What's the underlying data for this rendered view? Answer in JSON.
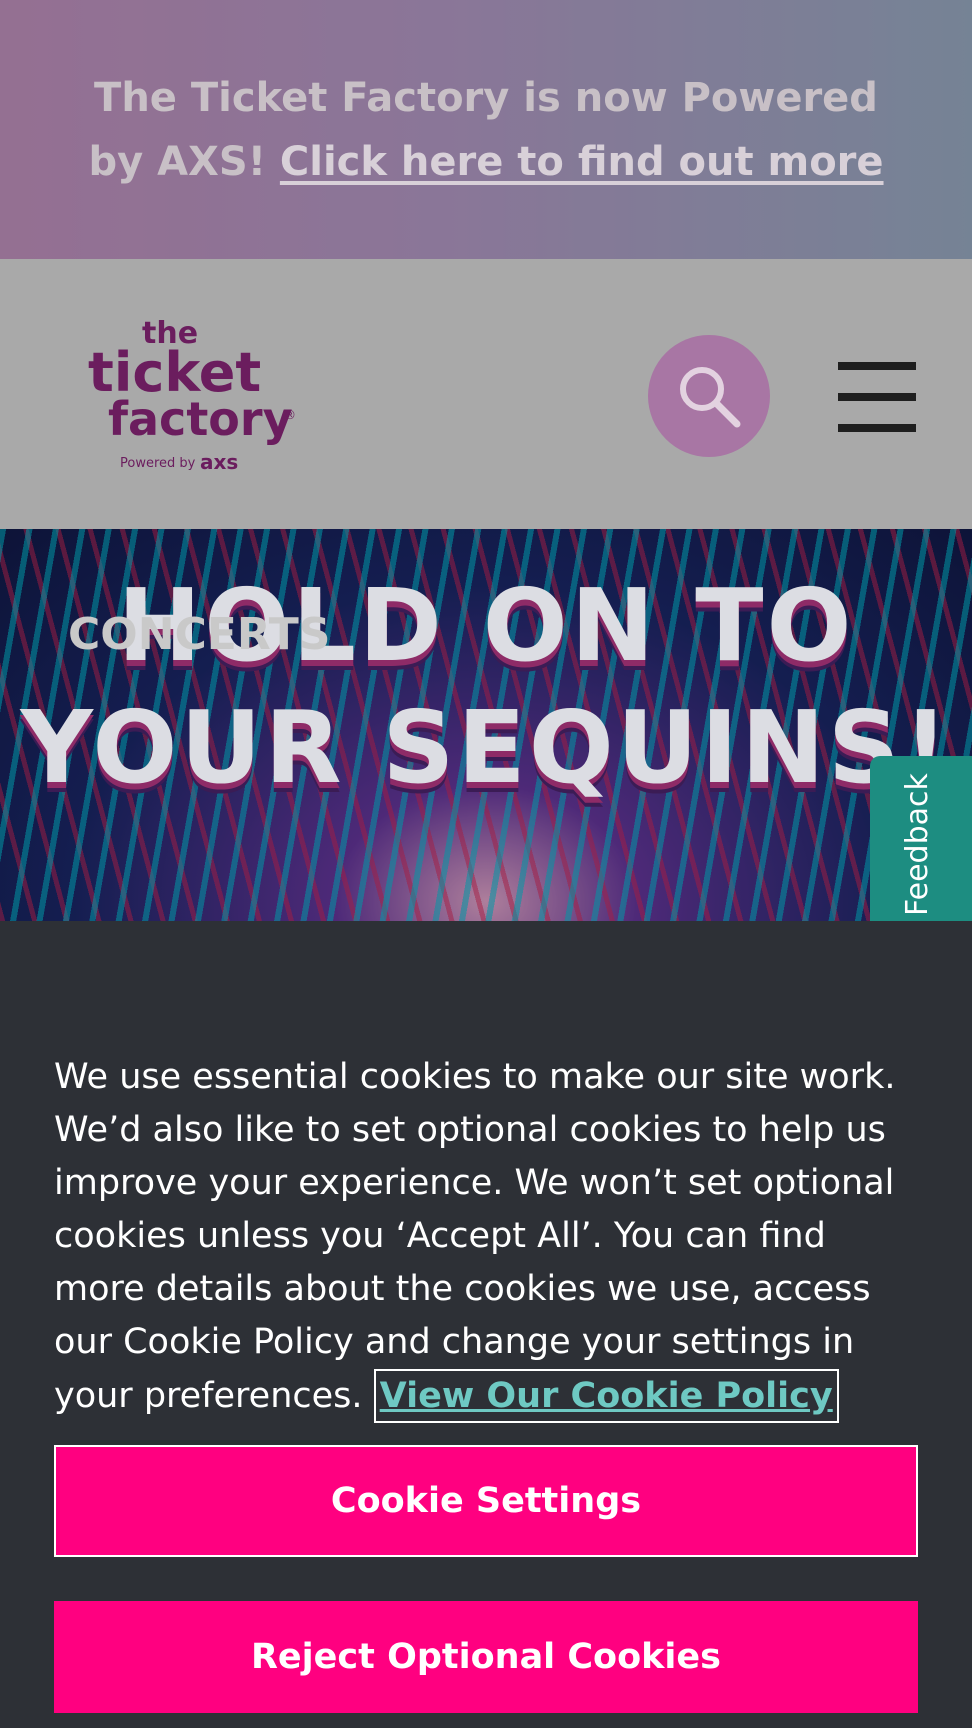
{
  "promo_banner": {
    "text": "The Ticket Factory is now Powered by AXS!",
    "link_text": "Click here to find out more"
  },
  "header": {
    "logo": {
      "line1": "the",
      "line2": "ticket",
      "line3": "factory",
      "tagline_prefix": "Powered by",
      "tagline_brand": "axs",
      "registered_mark": "®"
    },
    "search_icon": "search-icon",
    "menu_icon": "hamburger-menu-icon"
  },
  "hero": {
    "headline": "HOLD ON TO YOUR SEQUINS!",
    "category": "CONCERTS"
  },
  "feedback_tab": {
    "label": "Feedback"
  },
  "cookie_banner": {
    "message": "We use essential cookies to make our site work. We’d also like to set optional cookies to help us improve your experience. We won’t set optional cookies unless you ‘Accept All’. You can find more details about the cookies we use, access our Cookie Policy and change your settings in your preferences.",
    "policy_link": "View Our Cookie Policy",
    "settings_button": "Cookie Settings",
    "reject_button": "Reject Optional Cookies"
  },
  "colors": {
    "brand_purple": "#6b1d5e",
    "accent_pink": "#ff0080",
    "link_teal": "#6ec9c3",
    "feedback_green": "#1d8d81",
    "banner_bg": "#2d3036"
  }
}
